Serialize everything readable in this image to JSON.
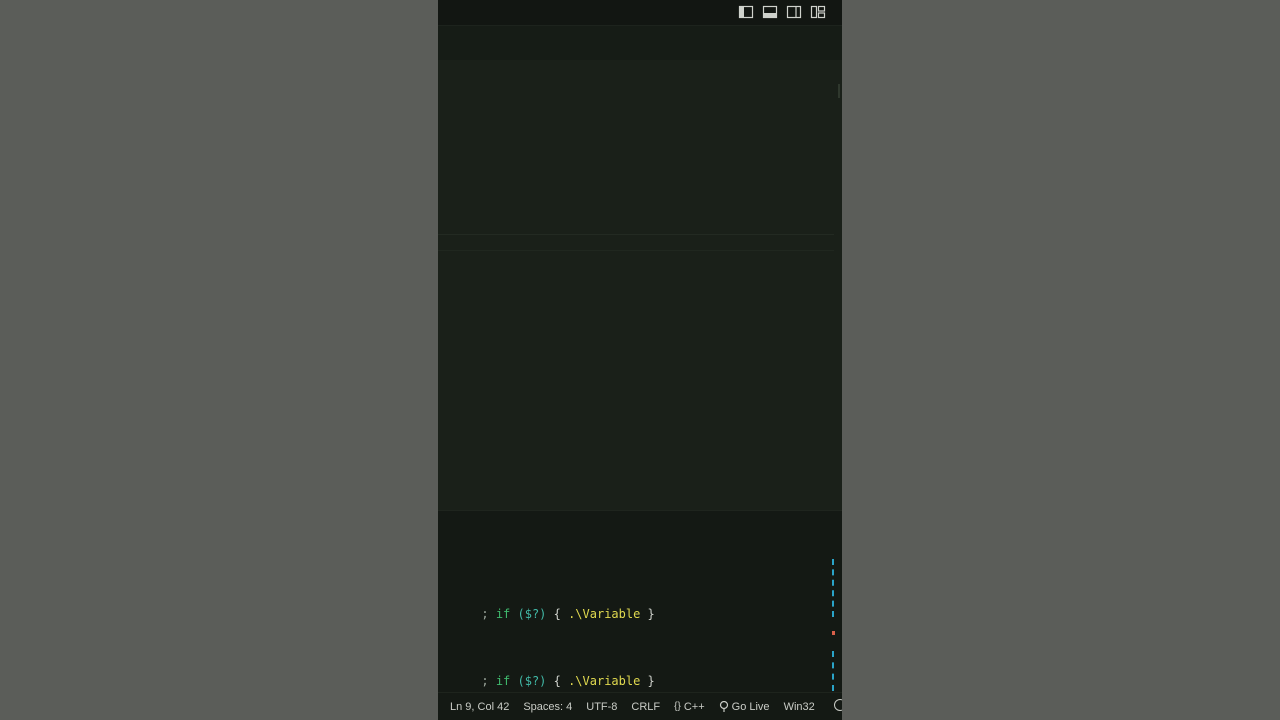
{
  "window": {
    "layout_toggles": [
      {
        "icon": "toggle-primary-sidebar-icon"
      },
      {
        "icon": "toggle-panel-icon"
      },
      {
        "icon": "toggle-secondary-sidebar-icon"
      },
      {
        "icon": "customize-layout-icon"
      }
    ]
  },
  "terminal": {
    "lines": [
      {
        "prompt": "; ",
        "kw": "if",
        "sv": " ($?)",
        "open": " { ",
        "exe": ".\\Variable",
        "close": " }"
      },
      {
        "prompt": "; ",
        "kw": "if",
        "sv": " ($?)",
        "open": " { ",
        "exe": ".\\Variable",
        "close": " }"
      }
    ]
  },
  "statusbar": {
    "position": "Ln 9, Col 42",
    "spaces": "Spaces: 4",
    "encoding": "UTF-8",
    "eol": "CRLF",
    "language": "C++",
    "language_icon": "{}",
    "golive": "Go Live",
    "platform": "Win32"
  },
  "colors": {
    "keyword": "#3fb96d",
    "variable": "#41b8a6",
    "executable": "#e0d94f",
    "background": "#151a15"
  }
}
